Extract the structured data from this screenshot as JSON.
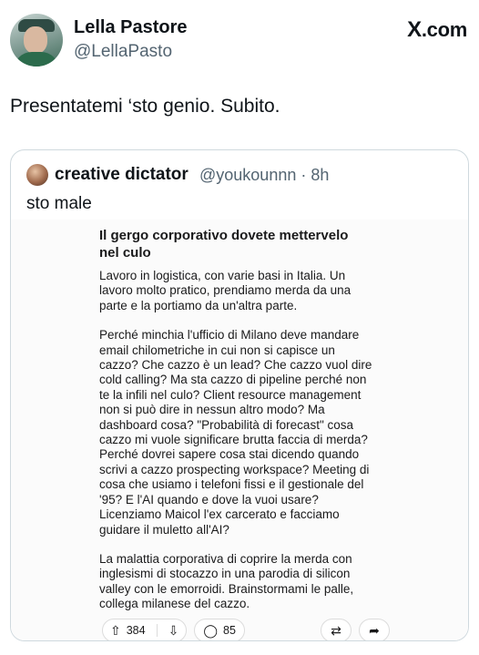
{
  "author": {
    "display_name": "Lella Pastore",
    "handle": "@LellaPasto",
    "avatar_icon": "profile-photo"
  },
  "brand": {
    "logo_glyph": "X",
    "suffix": ".com"
  },
  "tweet": {
    "text": "Presentatemi ‘sto genio. Subito."
  },
  "quoted": {
    "display_name": "creative dictator",
    "handle_time": "@youkounnn · 8h",
    "text": "sto male",
    "image": {
      "title": "Il gergo corporativo dovete mettervelo\nnel culo",
      "paragraphs": [
        "Lavoro in logistica, con varie basi in Italia. Un\nlavoro molto pratico, prendiamo merda da una\nparte e la portiamo da un'altra parte.",
        "Perché minchia l'ufficio di Milano deve mandare\nemail chilometriche in cui non si capisce un\ncazzo? Che cazzo è un lead? Che cazzo vuol dire\ncold calling? Ma sta cazzo di pipeline perché non\nte la infili nel culo? Client resource management\nnon si può dire in nessun altro modo? Ma\ndashboard cosa? \"Probabilità di forecast\" cosa\ncazzo mi vuole significare brutta faccia di merda?\nPerché dovrei sapere cosa stai dicendo quando\nscrivi a cazzo prospecting workspace? Meeting di\ncosa che usiamo i telefoni fissi e il gestionale del\n'95? E l'AI quando e dove la vuoi usare?\nLicenziamo Maicol l'ex carcerato e facciamo\nguidare il muletto all'AI?",
        "La malattia corporativa di coprire la merda con\ninglesismi di stocazzo in una parodia di silicon\nvalley con le emorroidi. Brainstormami le palle,\ncollega milanese del cazzo."
      ],
      "actions": {
        "upvote_icon": "upvote-arrow",
        "vote_count": "384",
        "downvote_icon": "downvote-arrow",
        "comment_icon": "comment-bubble",
        "comment_count": "85",
        "crosspost_icon": "crosspost-arrows",
        "share_icon": "share-arrow"
      }
    }
  }
}
